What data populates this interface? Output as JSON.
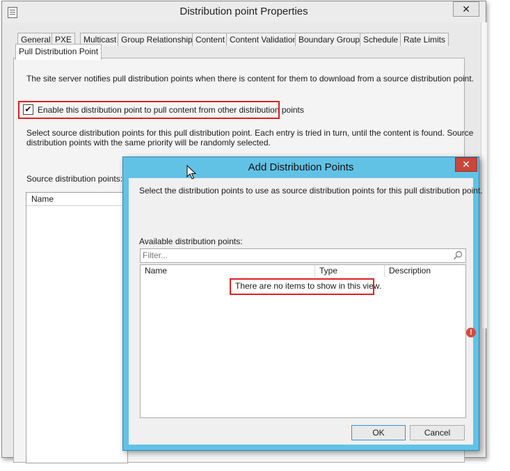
{
  "main_window": {
    "title": "Distribution point Properties",
    "close_glyph": "✕",
    "tabs": [
      {
        "label": "General"
      },
      {
        "label": "PXE"
      },
      {
        "label": "Multicast"
      },
      {
        "label": "Group Relationships"
      },
      {
        "label": "Content"
      },
      {
        "label": "Content Validation"
      },
      {
        "label": "Boundary Groups"
      },
      {
        "label": "Schedule"
      },
      {
        "label": "Rate Limits"
      },
      {
        "label": "Pull Distribution Point",
        "active": true
      }
    ],
    "panel": {
      "intro": "The site server notifies pull distribution points when there is content for them to download from a source distribution point.",
      "enable_checkbox": {
        "label": "Enable this distribution point to pull content from other distribution points",
        "checked": true,
        "check_glyph": "✔"
      },
      "select_text_line1": "Select source distribution points for this pull distribution point. Each entry is tried in turn, until the content is found. Source",
      "select_text_line2": "distribution points with the same priority will be randomly selected.",
      "source_label": "Source distribution points:",
      "source_list_header": "Name"
    }
  },
  "dialog": {
    "title": "Add Distribution Points",
    "close_glyph": "✕",
    "instruction": "Select the distribution points to use as source distribution points for this pull distribution point.",
    "available_label": "Available distribution points:",
    "filter": {
      "placeholder": "Filter...",
      "value": ""
    },
    "columns": [
      "Name",
      "Type",
      "Description"
    ],
    "empty_message": "There are no items to show in this view.",
    "ok_label": "OK",
    "cancel_label": "Cancel"
  },
  "icons": {
    "app": "properties-window-icon",
    "search": "search-icon",
    "error": "error-icon",
    "error_glyph": "!",
    "cursor": "mouse-pointer-icon"
  },
  "colors": {
    "dialog_frame": "#62c2e6",
    "close_button": "#c9463b",
    "highlight": "#e02020"
  }
}
